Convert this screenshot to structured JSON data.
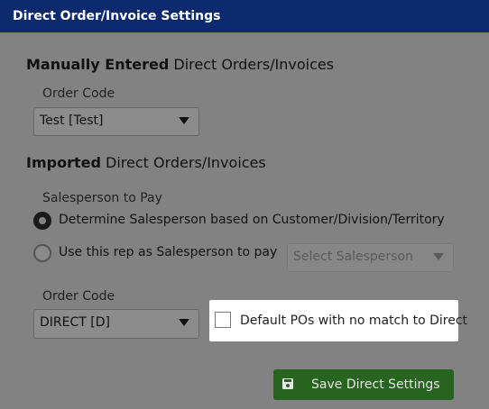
{
  "title": "Direct Order/Invoice Settings",
  "manual": {
    "heading_bold": "Manually Entered",
    "heading_rest": " Direct Orders/Invoices",
    "order_code_label": "Order Code",
    "order_code_value": "Test [Test]"
  },
  "imported": {
    "heading_bold": "Imported",
    "heading_rest": " Direct Orders/Invoices",
    "salesperson_label": "Salesperson to Pay",
    "radio_determine": "Determine Salesperson based on Customer/Division/Territory",
    "radio_use_rep": "Use this rep as Salesperson to pay",
    "salesperson_select": "Select Salesperson",
    "order_code_label": "Order Code",
    "order_code_value": "DIRECT [D]",
    "default_po_label": "Default POs with no match to Direct"
  },
  "save_button": "Save Direct Settings",
  "colors": {
    "titlebar": "#0d2a6f",
    "save_button": "#27641f"
  }
}
